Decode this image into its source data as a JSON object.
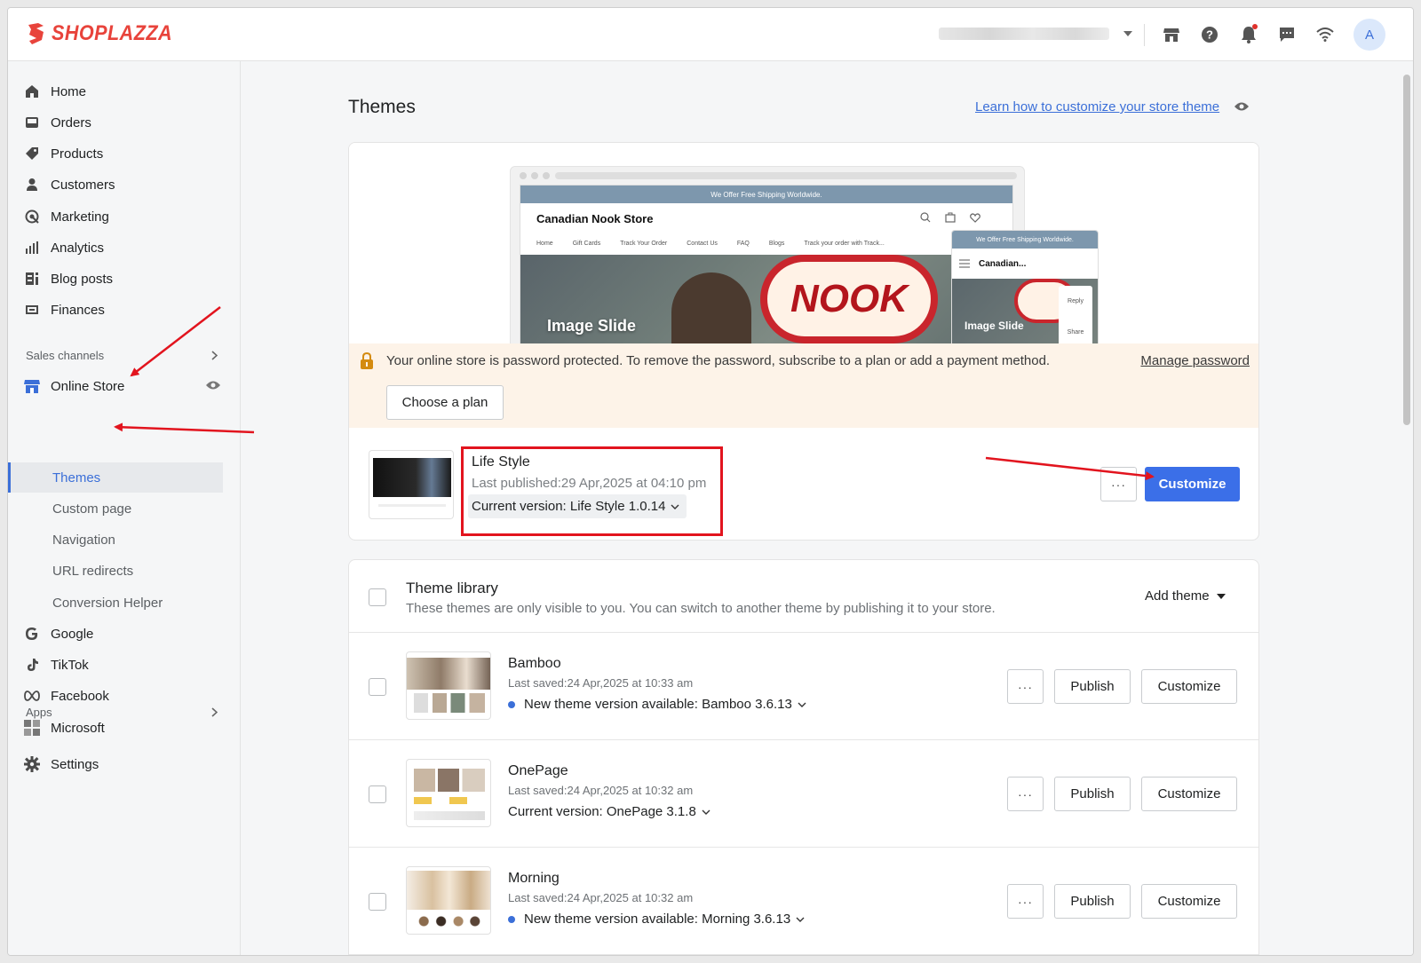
{
  "brand": {
    "name": "SHOPLAZZA",
    "color": "#e8433b"
  },
  "topbar": {
    "icons": [
      "store-icon",
      "help-icon",
      "bell-icon",
      "chat-icon",
      "wifi-icon"
    ],
    "avatar_initial": "A"
  },
  "sidebar": {
    "items": [
      {
        "label": "Home",
        "icon": "home-icon"
      },
      {
        "label": "Orders",
        "icon": "inbox-icon"
      },
      {
        "label": "Products",
        "icon": "tag-icon"
      },
      {
        "label": "Customers",
        "icon": "person-icon"
      },
      {
        "label": "Marketing",
        "icon": "target-icon"
      },
      {
        "label": "Analytics",
        "icon": "bar-chart-icon"
      },
      {
        "label": "Blog posts",
        "icon": "blog-icon"
      },
      {
        "label": "Finances",
        "icon": "finance-icon"
      }
    ],
    "sales_channels_label": "Sales channels",
    "online_store_label": "Online Store",
    "sub_items": [
      "Themes",
      "Custom page",
      "Navigation",
      "URL redirects",
      "Conversion Helper"
    ],
    "channels": [
      {
        "label": "Google",
        "icon": "google-icon"
      },
      {
        "label": "TikTok",
        "icon": "tiktok-icon"
      },
      {
        "label": "Facebook",
        "icon": "meta-icon"
      },
      {
        "label": "Microsoft",
        "icon": "microsoft-icon"
      }
    ],
    "apps_label": "Apps",
    "settings_label": "Settings"
  },
  "main": {
    "title": "Themes",
    "learn_link": "Learn how to customize your store theme",
    "preview": {
      "promo": "We Offer Free Shipping Worldwide.",
      "store_name": "Canadian Nook Store",
      "nav": [
        "Home",
        "Gift Cards",
        "Track Your Order",
        "Contact Us",
        "FAQ",
        "Blogs",
        "Track your order with Track..."
      ],
      "hero_text": "Image Slide",
      "sign_text": "NOOK",
      "mobile_store_name": "Canadian...",
      "mobile_actions": [
        "Reply",
        "Share"
      ]
    },
    "password_banner": {
      "text": "Your online store is password protected. To remove the password, subscribe to a plan or add a payment method.",
      "manage": "Manage password",
      "choose_plan": "Choose a plan"
    },
    "current_theme": {
      "name": "Life Style",
      "published": "Last published:29 Apr,2025 at 04:10 pm",
      "version": "Current version: Life Style 1.0.14",
      "more": "···",
      "customize": "Customize"
    },
    "library": {
      "title": "Theme library",
      "subtitle": "These themes are only visible to you. You can switch to another theme by publishing it to your store.",
      "add_theme": "Add theme",
      "publish_label": "Publish",
      "customize_label": "Customize",
      "more_label": "···",
      "themes": [
        {
          "name": "Bamboo",
          "saved": "Last saved:24 Apr,2025 at 10:33 am",
          "version": "New theme version available: Bamboo 3.6.13",
          "update": true
        },
        {
          "name": "OnePage",
          "saved": "Last saved:24 Apr,2025 at 10:32 am",
          "version": "Current version: OnePage 3.1.8",
          "update": false
        },
        {
          "name": "Morning",
          "saved": "Last saved:24 Apr,2025 at 10:32 am",
          "version": "New theme version available: Morning 3.6.13",
          "update": true
        }
      ]
    }
  },
  "colors": {
    "accent": "#3b6fe8",
    "annotation": "#e2141e",
    "banner_bg": "#fdf3e8"
  }
}
